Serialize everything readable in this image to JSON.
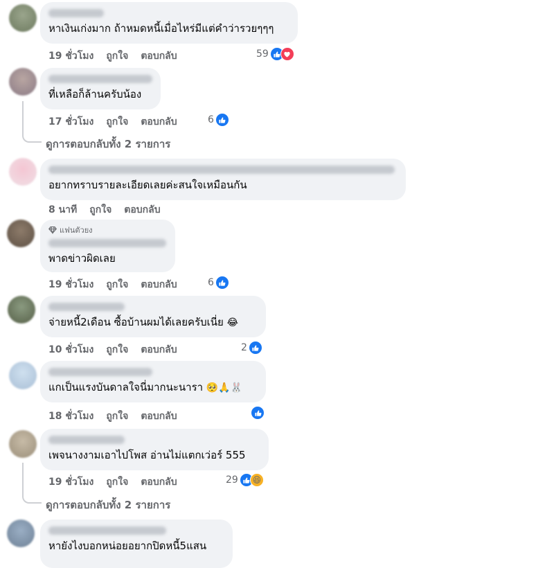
{
  "labels": {
    "like": "ถูกใจ",
    "reply": "ตอบกลับ"
  },
  "colors": {
    "bubble": "#f0f2f5",
    "meta": "#65676b",
    "like_blue": "#1877f2",
    "love_red": "#f33e58",
    "haha_yellow": "#f7b125"
  },
  "comments": [
    {
      "text": "หาเงินเก่งมาก ถ้าหมดหนี้เมื่อไหร่มีแต่คำว่ารวยๆๆๆ",
      "time": "19 ชั่วโมง",
      "reactions": "59",
      "icons": [
        "like-icon",
        "love-icon"
      ]
    },
    {
      "text": "ที่เหลือก็ล้านครับน้อง",
      "time": "17 ชั่วโมง",
      "reactions": "6",
      "icons": [
        "like-icon"
      ],
      "replies_link": "ดูการตอบกลับทั้ง 2 รายการ"
    },
    {
      "text": "อยากทราบรายละเอียดเลยค่ะสนใจเหมือนกัน",
      "time": "8 นาที",
      "reactions": "",
      "icons": []
    },
    {
      "badge": "แฟนตัวยง",
      "text": "พาดข่าวผิดเลย",
      "time": "19 ชั่วโมง",
      "reactions": "6",
      "icons": [
        "like-icon"
      ]
    },
    {
      "text": "จ่ายหนี้2เดือน ซื้อบ้านผมได้เลยครับเนี่ย",
      "emoji": "😂",
      "time": "10 ชั่วโมง",
      "reactions": "2",
      "icons": [
        "like-icon"
      ]
    },
    {
      "text": "แกเป็นแรงบันดาลใจนี่มากนะนารา",
      "emoji": "🥺🙏🐰",
      "time": "18 ชั่วโมง",
      "reactions": "",
      "icons": [
        "like-icon"
      ]
    },
    {
      "text": "เพจนางงามเอาไปโพส อ่านไม่แตกเว่อร์ 555",
      "time": "19 ชั่วโมง",
      "reactions": "29",
      "icons": [
        "like-icon",
        "haha-icon"
      ],
      "replies_link": "ดูการตอบกลับทั้ง 2 รายการ"
    },
    {
      "text": "หายังไงบอกหน่อยอยากปิดหนี้5แสน"
    }
  ]
}
